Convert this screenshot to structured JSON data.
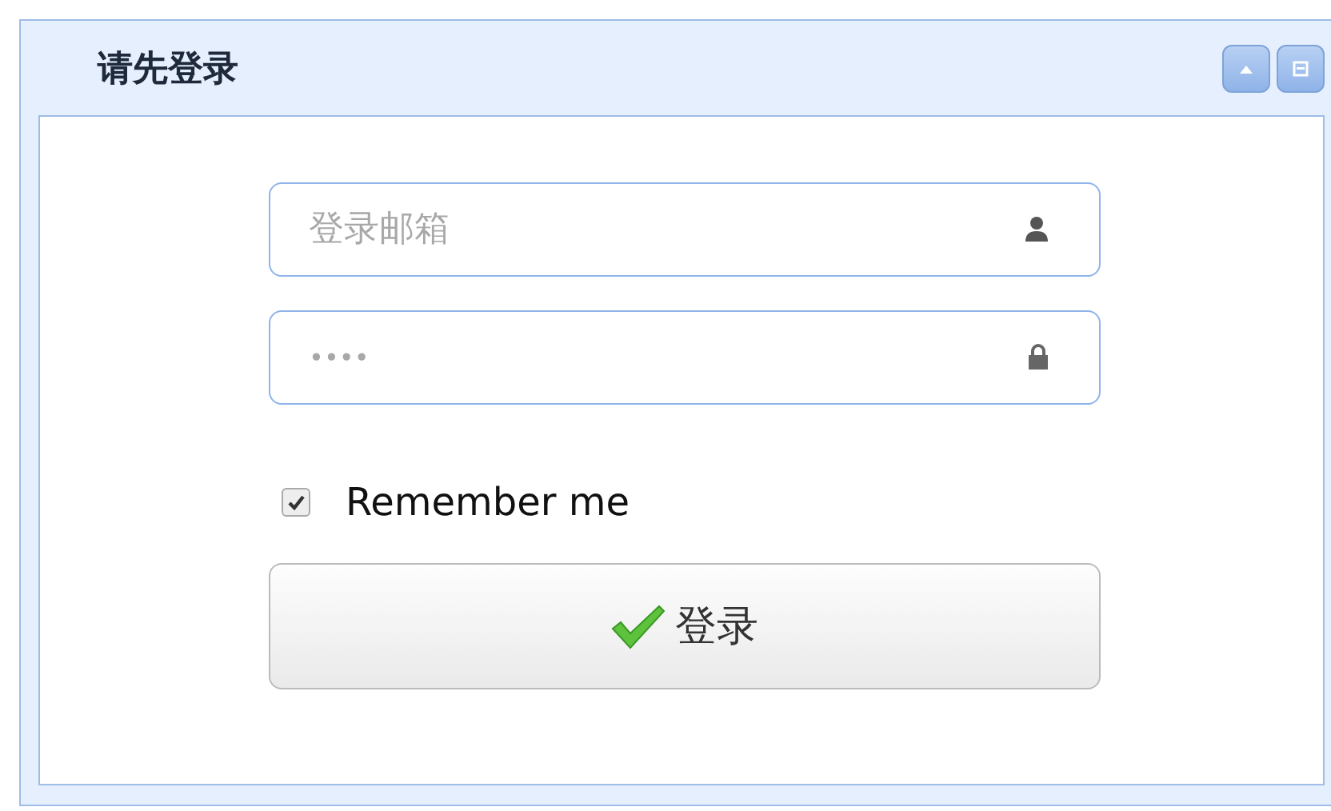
{
  "panel": {
    "title": "请先登录"
  },
  "fields": [
    {
      "kind": "email",
      "placeholder": "登录邮箱"
    },
    {
      "kind": "password",
      "placeholder": "••••"
    }
  ],
  "remember": {
    "label": "Remember me",
    "checked": true
  },
  "submit": {
    "label": "登录"
  }
}
